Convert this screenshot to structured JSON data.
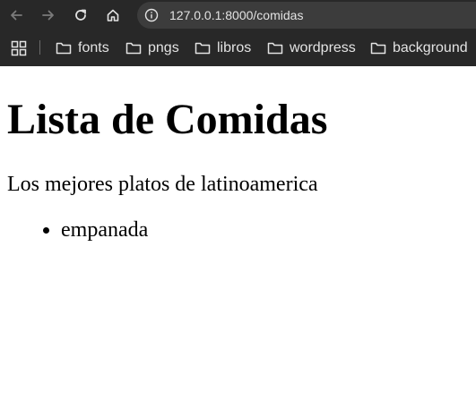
{
  "browser": {
    "url": "127.0.0.1:8000/comidas",
    "nav_icons": [
      "back-arrow-icon",
      "forward-arrow-icon",
      "reload-icon",
      "home-icon"
    ],
    "site_info_icon": "info-circle-icon",
    "colors": {
      "chrome_bg": "#282828",
      "omnibox_bg": "#3c3c3c",
      "text": "#e3e3e3",
      "disabled_icon": "#7a7a7a"
    }
  },
  "bookmarks": {
    "apps_icon": "apps-grid-icon",
    "items": [
      {
        "label": "fonts",
        "icon": "folder-icon"
      },
      {
        "label": "pngs",
        "icon": "folder-icon"
      },
      {
        "label": "libros",
        "icon": "folder-icon"
      },
      {
        "label": "wordpress",
        "icon": "folder-icon"
      },
      {
        "label": "background",
        "icon": "folder-icon"
      }
    ]
  },
  "page": {
    "title": "Lista de Comidas",
    "subtitle": "Los mejores platos de latinoamerica",
    "items": [
      "empanada"
    ]
  }
}
